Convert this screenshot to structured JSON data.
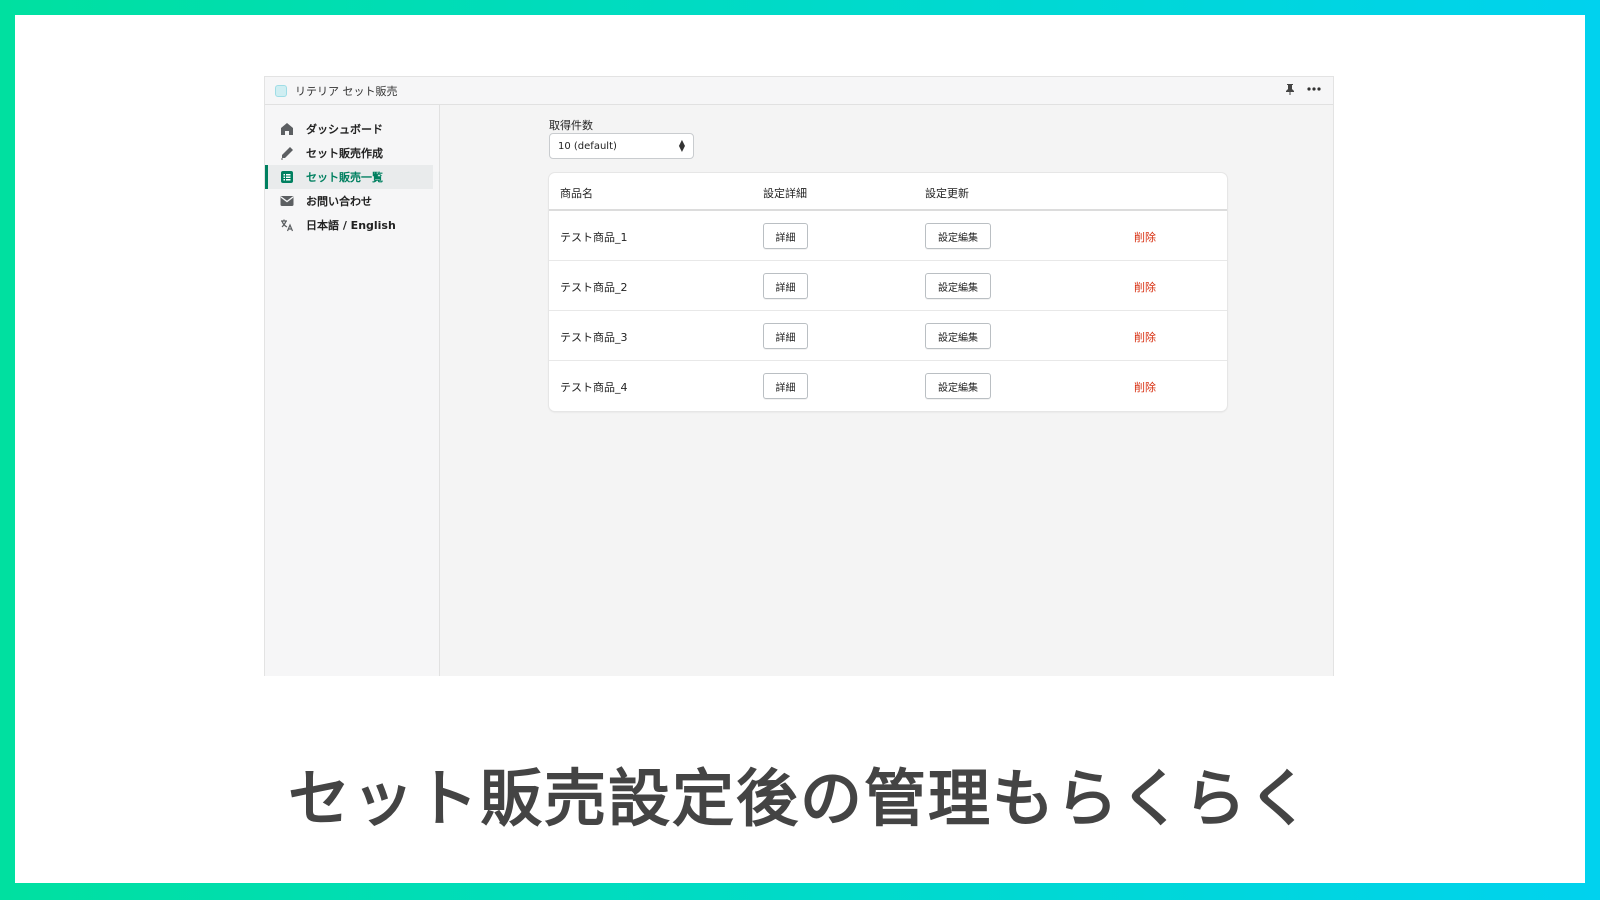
{
  "app": {
    "title": "リテリア セット販売"
  },
  "sidebar": {
    "items": [
      {
        "label": "ダッシュボード",
        "icon": "home-icon"
      },
      {
        "label": "セット販売作成",
        "icon": "pencil-icon"
      },
      {
        "label": "セット販売一覧",
        "icon": "list-icon",
        "active": true
      },
      {
        "label": "お問い合わせ",
        "icon": "mail-icon"
      },
      {
        "label": "日本語 / English",
        "icon": "translate-icon"
      }
    ]
  },
  "main": {
    "fetch_label": "取得件数",
    "fetch_select": "10 (default)",
    "table": {
      "headers": [
        "商品名",
        "設定詳細",
        "設定更新"
      ],
      "rows": [
        {
          "name": "テスト商品_1",
          "detail": "詳細",
          "edit": "設定編集",
          "delete": "削除"
        },
        {
          "name": "テスト商品_2",
          "detail": "詳細",
          "edit": "設定編集",
          "delete": "削除"
        },
        {
          "name": "テスト商品_3",
          "detail": "詳細",
          "edit": "設定編集",
          "delete": "削除"
        },
        {
          "name": "テスト商品_4",
          "detail": "詳細",
          "edit": "設定編集",
          "delete": "削除"
        }
      ]
    }
  },
  "caption": "セット販売設定後の管理もらくらく",
  "colors": {
    "accent": "#008060",
    "danger": "#d72c0d",
    "frame_gradient": [
      "#00e0a0",
      "#00d2ee"
    ]
  }
}
